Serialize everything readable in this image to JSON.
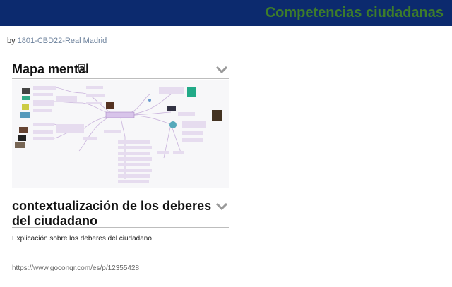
{
  "header": {
    "title": "Competencias ciudadanas"
  },
  "byline": {
    "prefix": "by",
    "author": "1801-CBD22-Real Madrid"
  },
  "sections": [
    {
      "title": "Mapa mental",
      "toggle_icon": "chevron-down-icon",
      "zoom_icon": "zoom-icon"
    },
    {
      "title": "contextualización de los deberes del ciudadano",
      "toggle_icon": "chevron-down-icon",
      "body": "Explicación sobre los deberes del ciudadano"
    }
  ],
  "mindmap": {
    "center_label": "Competencias Ciudadanas"
  },
  "footer": {
    "url": "https://www.goconqr.com/es/p/12355428"
  },
  "colors": {
    "header_bg": "#0c2a6e",
    "title": "#3e7d2a",
    "node": "#e6dcef",
    "line": "#b89ad0"
  }
}
